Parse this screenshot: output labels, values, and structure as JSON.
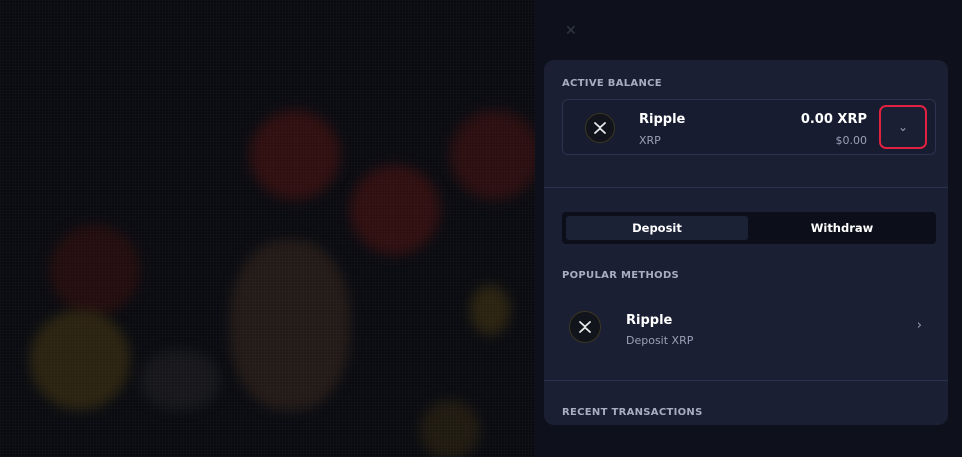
{
  "wallet": {
    "active_balance_label": "ACTIVE BALANCE",
    "balance": {
      "coin_name": "Ripple",
      "coin_code": "XRP",
      "amount": "0.00 XRP",
      "usd_value": "$0.00",
      "icon": "ripple-icon",
      "dropdown_icon": "chevron-down-icon"
    },
    "tabs": [
      {
        "label": "Deposit",
        "active": true
      },
      {
        "label": "Withdraw",
        "active": false
      }
    ],
    "popular_methods_label": "POPULAR METHODS",
    "methods": [
      {
        "name": "Ripple",
        "subtitle": "Deposit XRP",
        "icon": "ripple-icon",
        "arrow_icon": "chevron-right-icon"
      }
    ],
    "recent_transactions_label": "RECENT TRANSACTIONS"
  },
  "colors": {
    "card_bg": "#1a1f33",
    "highlight_border": "#e0213f",
    "muted_text": "#9aa0b8"
  }
}
